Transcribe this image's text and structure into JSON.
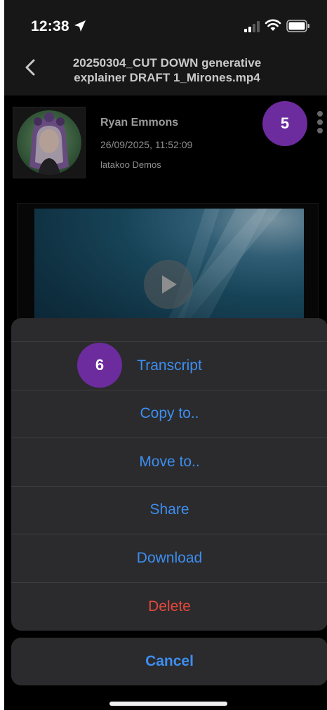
{
  "status_bar": {
    "time": "12:38"
  },
  "header": {
    "title_line1": "20250304_CUT DOWN generative",
    "title_line2": "explainer DRAFT 1_Mirones.mp4"
  },
  "author": {
    "name": "Ryan Emmons",
    "date": "26/09/2025, 11:52:09",
    "org": "latakoo Demos"
  },
  "badges": {
    "more": "5",
    "transcript": "6"
  },
  "action_sheet": {
    "items": [
      {
        "label": "Transcript"
      },
      {
        "label": "Copy to.."
      },
      {
        "label": "Move to.."
      },
      {
        "label": "Share"
      },
      {
        "label": "Download"
      },
      {
        "label": "Delete"
      }
    ],
    "cancel_label": "Cancel"
  },
  "colors": {
    "accent": "#3d8ef0",
    "destructive": "#e5473c",
    "badge": "#6c2c9e",
    "sheet": "#2b2b2d"
  }
}
